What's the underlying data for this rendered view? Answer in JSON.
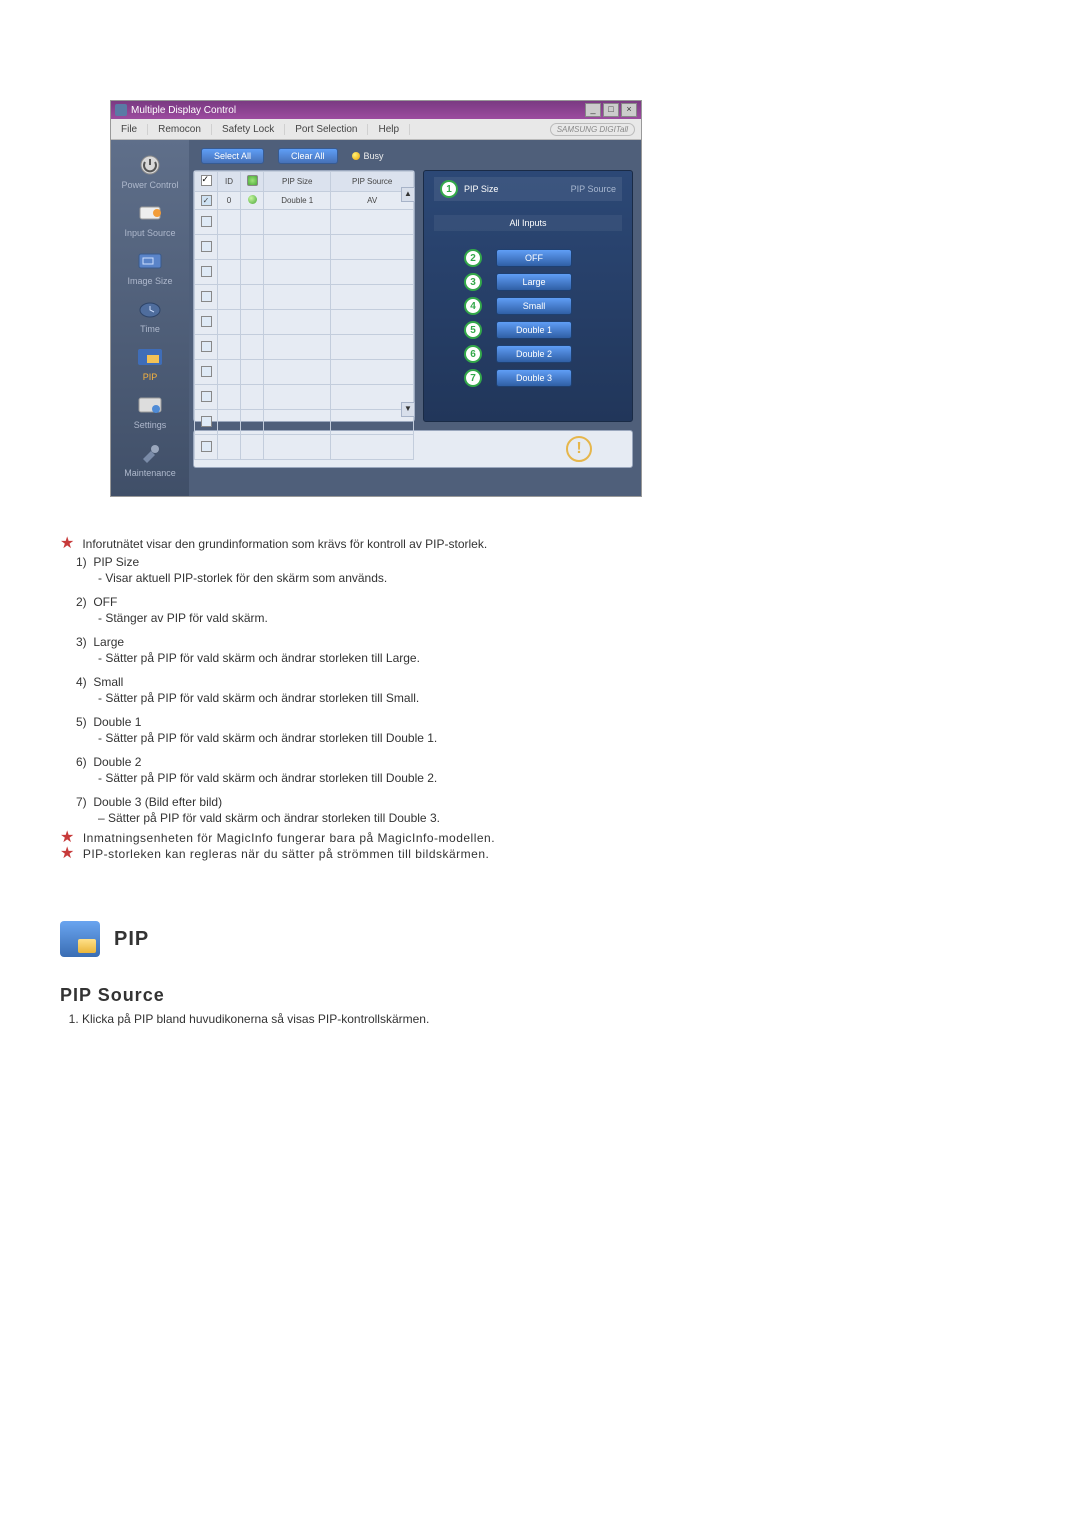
{
  "window": {
    "title": "Multiple Display Control",
    "brand": "SAMSUNG DIGITall"
  },
  "menu": {
    "file": "File",
    "remocon": "Remocon",
    "safetyLock": "Safety Lock",
    "portSelection": "Port Selection",
    "help": "Help"
  },
  "sidebar": {
    "items": [
      {
        "label": "Power Control"
      },
      {
        "label": "Input Source"
      },
      {
        "label": "Image Size"
      },
      {
        "label": "Time"
      },
      {
        "label": "PIP"
      },
      {
        "label": "Settings"
      },
      {
        "label": "Maintenance"
      }
    ]
  },
  "toolbar": {
    "selectAll": "Select All",
    "clearAll": "Clear All",
    "busy": "Busy"
  },
  "grid": {
    "cols": {
      "id": "ID",
      "pipSize": "PIP Size",
      "pipSource": "PIP Source"
    },
    "row0": {
      "id": "0",
      "pipSize": "Double 1",
      "pipSource": "AV"
    }
  },
  "options": {
    "headLeft": "PIP Size",
    "headRight": "PIP Source",
    "allInputs": "All Inputs",
    "off": "OFF",
    "large": "Large",
    "small": "Small",
    "d1": "Double 1",
    "d2": "Double 2",
    "d3": "Double 3",
    "n1": "1",
    "n2": "2",
    "n3": "3",
    "n4": "4",
    "n5": "5",
    "n6": "6",
    "n7": "7"
  },
  "doc": {
    "intro": "Inforutnätet visar den grundinformation som krävs för kontroll av PIP-storlek.",
    "i1t": "PIP Size",
    "i1d": "- Visar aktuell PIP-storlek för den skärm som används.",
    "i2t": "OFF",
    "i2d": "- Stänger av PIP för vald skärm.",
    "i3t": "Large",
    "i3d": "- Sätter på PIP för vald skärm och ändrar storleken till Large.",
    "i4t": "Small",
    "i4d": "- Sätter på PIP för vald skärm och ändrar storleken till Small.",
    "i5t": "Double 1",
    "i5d": "- Sätter på PIP för vald skärm och ändrar storleken till Double 1.",
    "i6t": "Double 2",
    "i6d": "- Sätter på PIP för vald skärm och ändrar storleken till Double 2.",
    "i7t": "Double 3 (Bild efter bild)",
    "i7d": "– Sätter på PIP för vald skärm och ändrar storleken till Double 3.",
    "note1": "Inmatningsenheten för MagicInfo fungerar bara på MagicInfo-modellen.",
    "note2": "PIP-storleken kan regleras när du sätter på strömmen till bildskärmen.",
    "section": "PIP",
    "subhead": "PIP Source",
    "step1": "Klicka på PIP bland huvudikonerna så visas PIP-kontrollskärmen."
  },
  "labels": {
    "n1": "1)",
    "n2": "2)",
    "n3": "3)",
    "n4": "4)",
    "n5": "5)",
    "n6": "6)",
    "n7": "7)"
  }
}
